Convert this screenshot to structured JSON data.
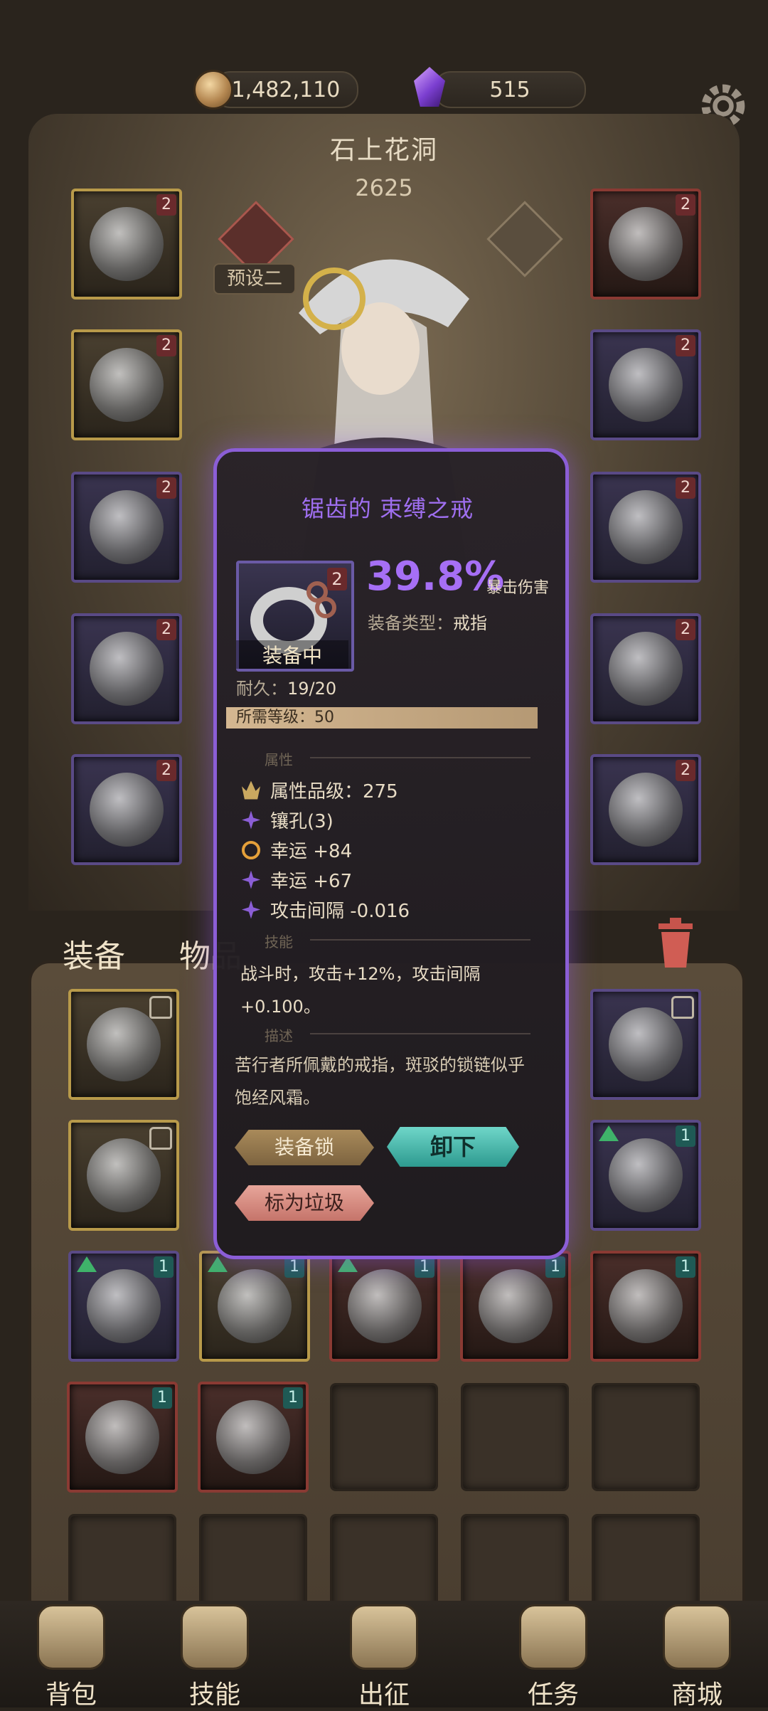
{
  "resources": {
    "gold": "1,482,110",
    "gems": "515"
  },
  "header": {
    "location": "石上花洞",
    "power": "2625",
    "preset": "预设二"
  },
  "tabs": {
    "equipment": "装备",
    "items": "物品"
  },
  "tooltip": {
    "name": "锯齿的 束缚之戒",
    "level_badge": "2",
    "equipped": "装备中",
    "main_stat_value": "39.8%",
    "main_stat_name": "暴击伤害",
    "type_label": "装备类型：",
    "type_value": "戒指",
    "durability_label": "耐久：",
    "durability_value": "19/20",
    "required_level": "所需等级：50",
    "section_attrs": "属性",
    "attributes": [
      "属性品级：275",
      "镶孔(3)",
      "幸运 +84",
      "幸运 +67",
      "攻击间隔 -0.016"
    ],
    "section_skill": "技能",
    "skill_text": "战斗时，攻击+12%，攻击间隔+0.100。",
    "section_desc": "描述",
    "description": "苦行者所佩戴的戒指，斑驳的锁链似乎饱经风霜。",
    "btn_lock": "装备锁",
    "btn_unequip": "卸下",
    "btn_junk": "标为垃圾"
  },
  "nav": [
    "背包",
    "技能",
    "出征",
    "任务",
    "商城"
  ],
  "badge_numbers": {
    "level2": "2",
    "level1": "1"
  },
  "colors": {
    "accent_purple": "#a66ff5",
    "teal": "#2d9a8f",
    "gold": "#c9a860"
  }
}
